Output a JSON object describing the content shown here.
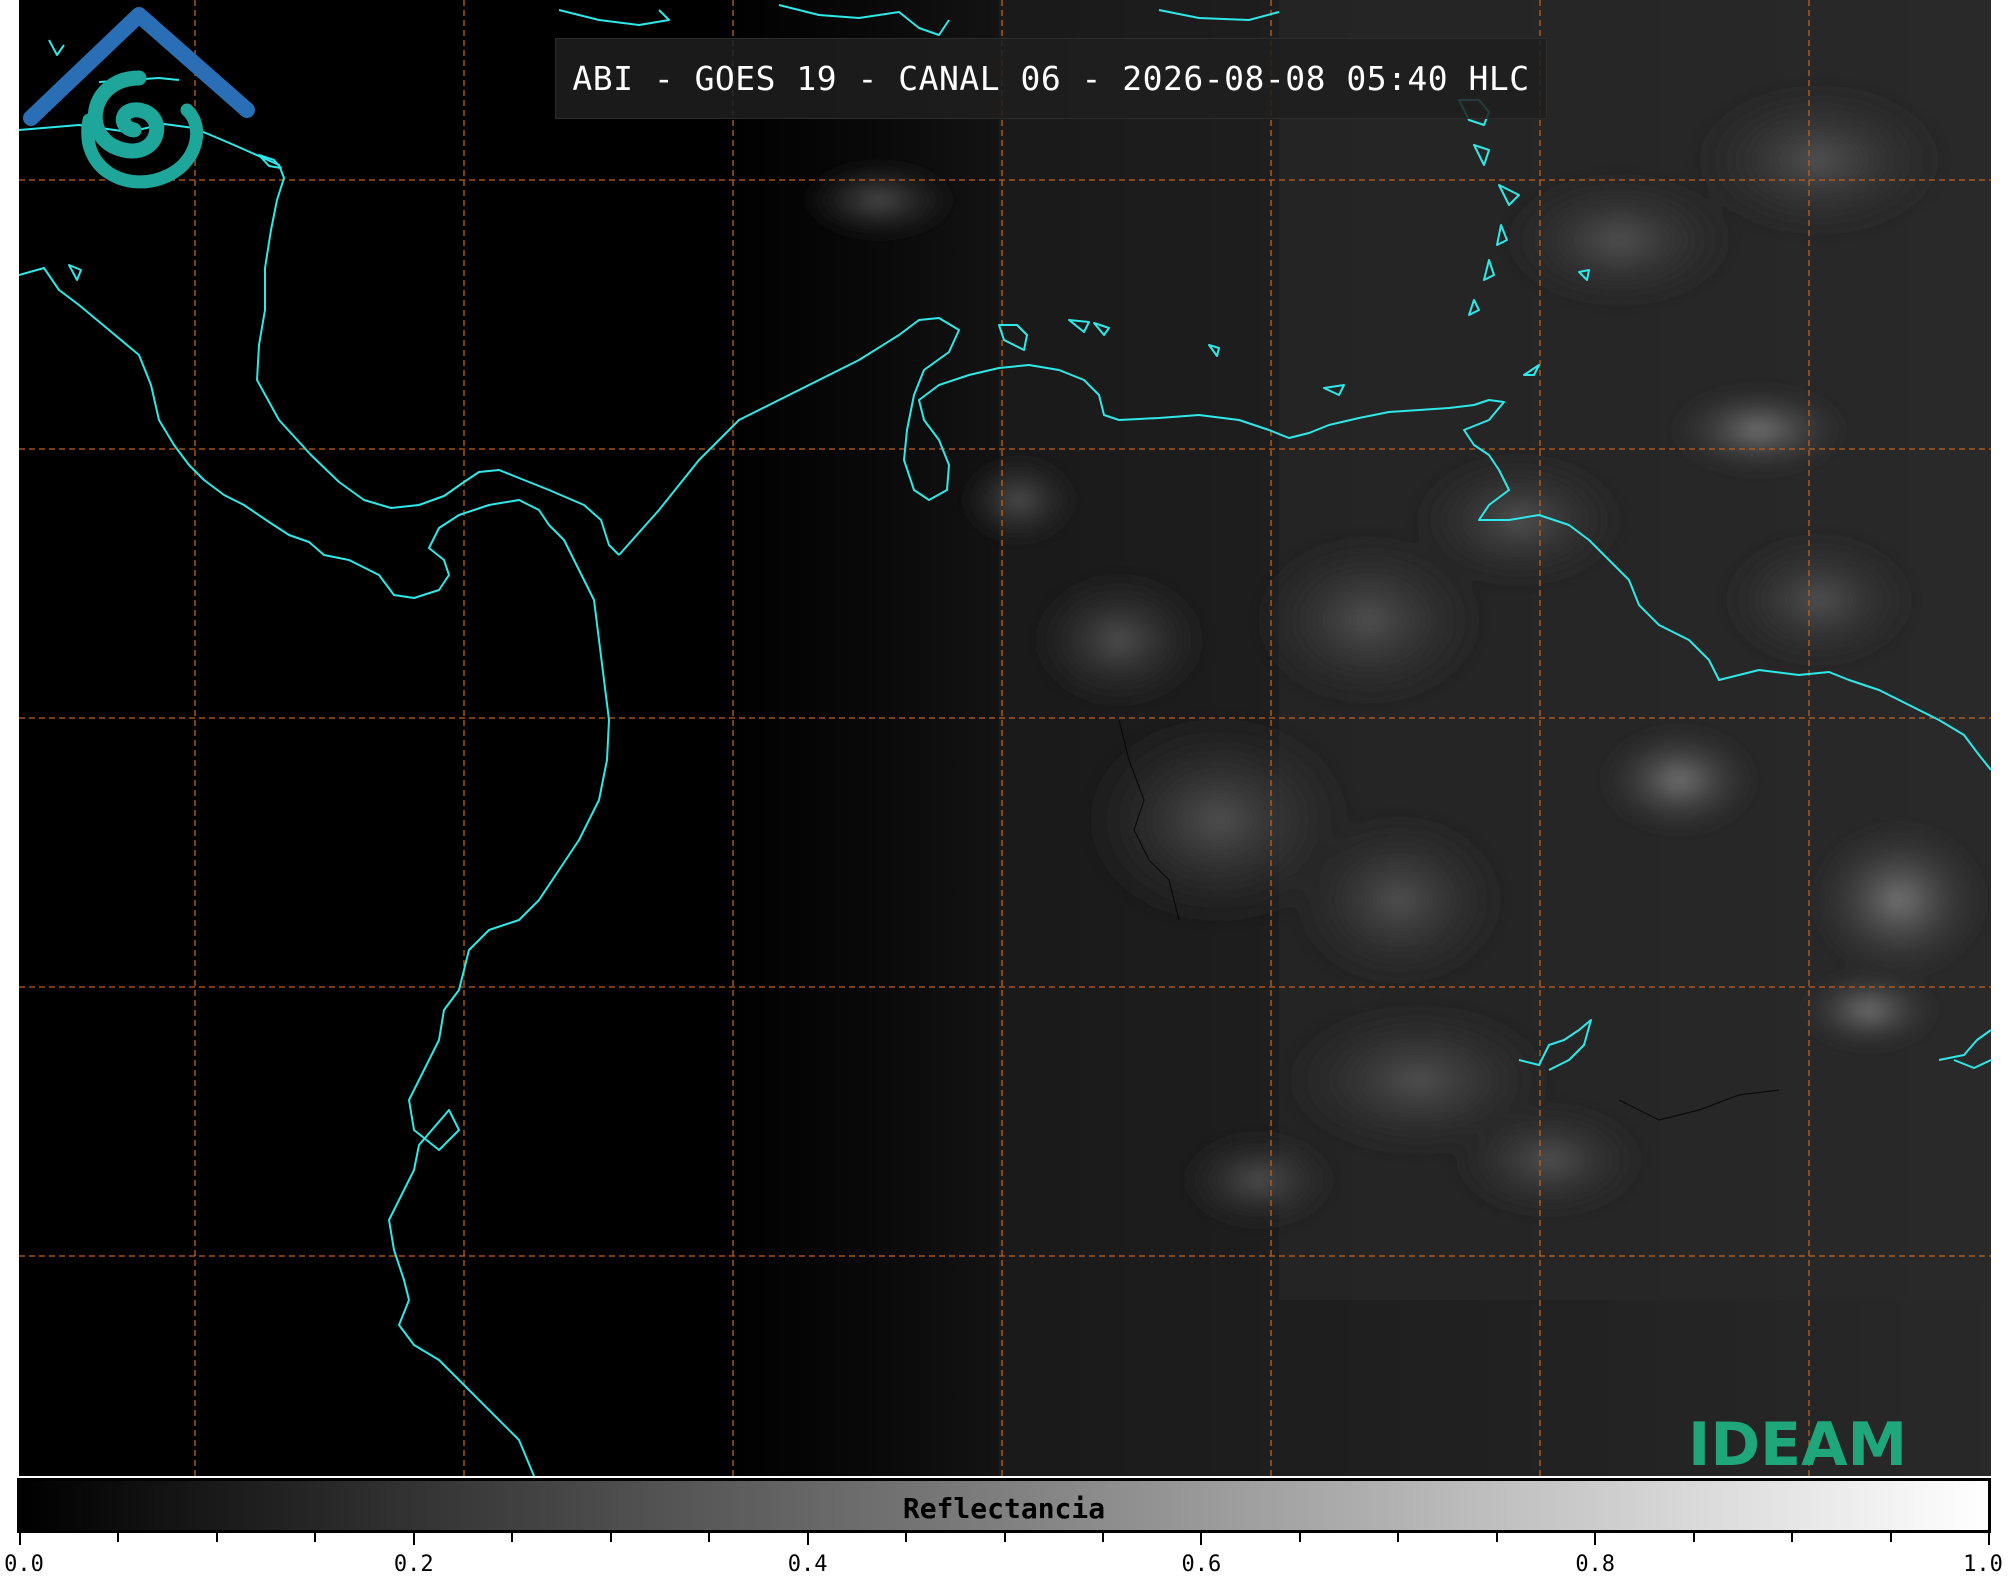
{
  "title": "ABI - GOES 19 - CANAL 06 - 2026-08-08 05:40 HLC",
  "colorbar": {
    "label": "Reflectancia",
    "min": 0.0,
    "max": 1.0,
    "tick_labels": [
      "0.0",
      "0.2",
      "0.4",
      "0.6",
      "0.8",
      "1.0"
    ],
    "colormap": "grayscale",
    "color_low": "#000000",
    "color_high": "#ffffff"
  },
  "map": {
    "background_color": "#000000",
    "coastline_color": "#2fe8e8",
    "gridline_color": "#c0611a",
    "gridline_style": "dashed",
    "cloud_cover_region": "east"
  },
  "logo": {
    "text": "IDEAM",
    "text_color": "#1fa67a",
    "roof_color": "#2a6fb5",
    "swirl_color": "#1fa69a"
  }
}
